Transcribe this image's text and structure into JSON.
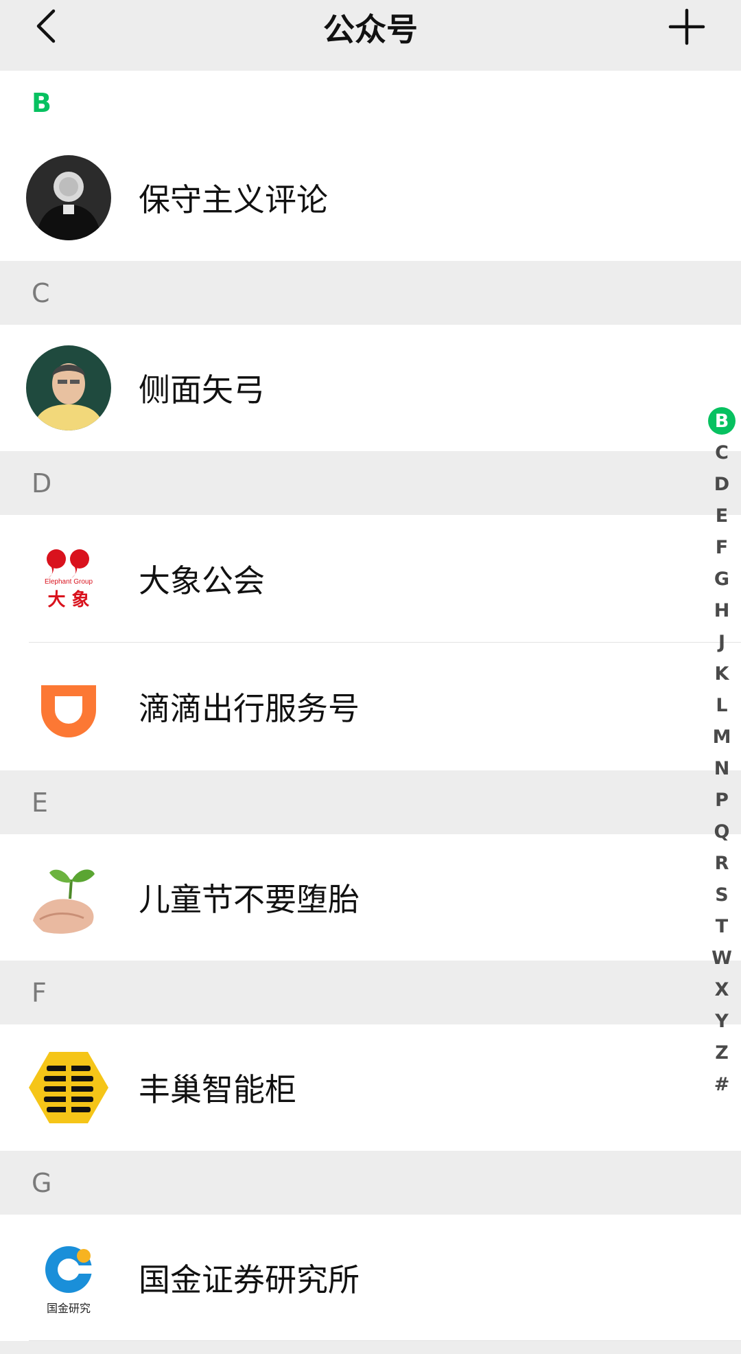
{
  "header": {
    "title": "公众号",
    "back_icon": "chevron-left-icon",
    "add_icon": "plus-icon"
  },
  "accent_color": "#07c160",
  "sections": [
    {
      "letter": "B",
      "accounts": [
        {
          "name": "保守主义评论",
          "avatar": "portrait-photo"
        }
      ]
    },
    {
      "letter": "C",
      "accounts": [
        {
          "name": "侧面矢弓",
          "avatar": "portrait-photo"
        }
      ]
    },
    {
      "letter": "D",
      "accounts": [
        {
          "name": "大象公会",
          "avatar": "elephant-group-logo",
          "logo_text": "Elephant Group",
          "logo_cn": "大 象"
        },
        {
          "name": "滴滴出行服务号",
          "avatar": "didi-logo"
        }
      ]
    },
    {
      "letter": "E",
      "accounts": [
        {
          "name": "儿童节不要堕胎",
          "avatar": "hand-with-sprout-image"
        }
      ]
    },
    {
      "letter": "F",
      "accounts": [
        {
          "name": "丰巢智能柜",
          "avatar": "fengchao-hexagon-logo"
        }
      ]
    },
    {
      "letter": "G",
      "accounts": [
        {
          "name": "国金证券研究所",
          "avatar": "guojin-logo",
          "logo_cn": "国金研究"
        }
      ]
    }
  ],
  "index_letters": [
    "B",
    "C",
    "D",
    "E",
    "F",
    "G",
    "H",
    "J",
    "K",
    "L",
    "M",
    "N",
    "P",
    "Q",
    "R",
    "S",
    "T",
    "W",
    "X",
    "Y",
    "Z",
    "#"
  ],
  "index_active": "B"
}
